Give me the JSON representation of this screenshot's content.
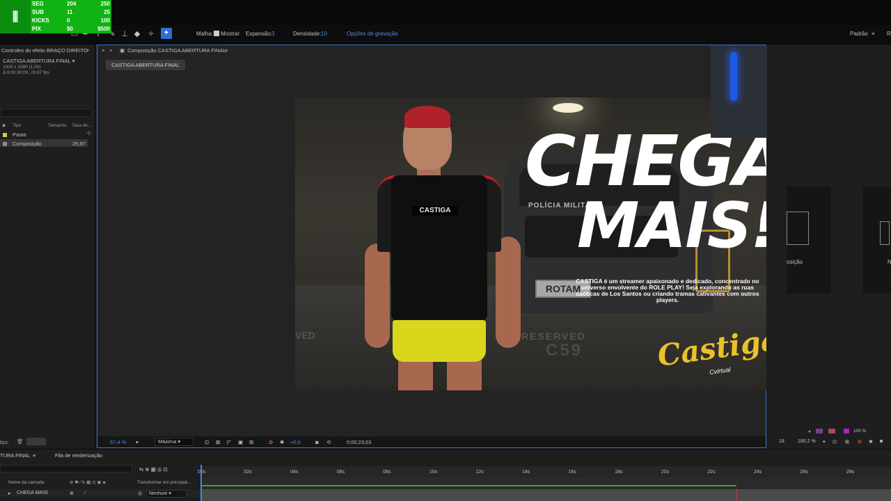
{
  "overlay": {
    "rows": [
      {
        "label": "SEG",
        "value": "204",
        "goal": "250"
      },
      {
        "label": "SUB",
        "value": "11",
        "goal": "25"
      },
      {
        "label": "KICKS",
        "value": "0",
        "goal": "100"
      },
      {
        "label": "PIX",
        "value": "$0",
        "goal": "$500"
      }
    ]
  },
  "toolbar": {
    "malha_label": "Malha:",
    "mostrar_label": "Mostrar",
    "expansao_label": "Expansão:",
    "expansao_value": "3",
    "densidade_label": "Densidade:",
    "densidade_value": "10",
    "opcoes_label": "Opções de gravação",
    "workspace_label": "Padrão",
    "workspace_next": "R"
  },
  "left_panel": {
    "header": "Controles do efeito BRAÇO DIREITO",
    "comp_name": "CASTIGA ABERTURA FINAL",
    "comp_res": "1920 x 1080 (1,00)",
    "comp_dur": "Δ 0;00;30;00, 29,97 fps",
    "col_tipo": "Tipo",
    "col_tamanho": "Tamanho",
    "col_taxa": "Taxa de...",
    "items": [
      {
        "label": "Pasta",
        "rate": "",
        "color": "#d9c84a"
      },
      {
        "label": "Composição",
        "rate": "29,97",
        "color": "#9c8a75"
      }
    ],
    "footer_label": "bpc"
  },
  "viewer": {
    "tab_label": "Composição CASTIGA ABERTURA FINAL",
    "comp_chip": "CASTIGA ABERTURA FINAL",
    "zoom": "57,4 %",
    "quality": "Máxima",
    "exposure": "+0,0",
    "timecode": "0;00;23;03"
  },
  "artwork": {
    "headline_1": "CHEGA",
    "headline_2": "MAIS!",
    "description": "CASTIGA é um streamer apaixonado e dedicado, concentrado no universo envolvente do ROLE PLAY! Seja explorando as ruas caóticas de Los Santos ou criando tramas cativantes com outros players.",
    "vest_label": "CASTIGA",
    "car_label": "POLÍCIA MILITAR",
    "plate": "ROTAM",
    "floor_text": "RESERVED",
    "floor_num": "C59",
    "floor_text_left": "VED",
    "logo": "Castiga",
    "logo_sub": "Cvirtual"
  },
  "right_panel": {
    "card_label": "osição",
    "card_label_2": "N",
    "zoom": "180,2 %",
    "percent": "100 %",
    "frame_label": "18"
  },
  "timeline": {
    "tab_comp": "TURA FINAL",
    "tab_render": "Fila de renderização",
    "col_name": "Nome da camada",
    "col_parent": "Transformar em principal...",
    "layer_name": "CHEGA   MAIS!",
    "layer_parent": "Nenhum",
    "ticks": [
      "00s",
      "02s",
      "04s",
      "06s",
      "08s",
      "10s",
      "12s",
      "14s",
      "16s",
      "18s",
      "20s",
      "22s",
      "24s",
      "26s",
      "28s"
    ]
  }
}
